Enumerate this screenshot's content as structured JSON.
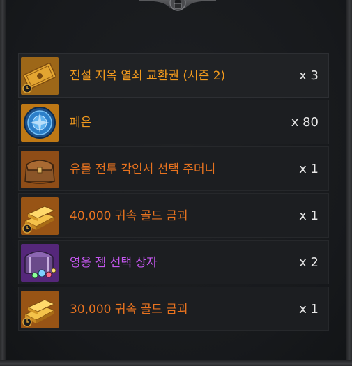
{
  "colors": {
    "legendary": "#f29a1d",
    "legendary_alt": "#e8731f",
    "mythic": "#c557f0",
    "quantity": "#e7e7e7"
  },
  "items": [
    {
      "name": "전설 지옥 열쇠 교환권 (시즌 2)",
      "quantity": "x 3",
      "rarity": "legendary",
      "icon": "legendary-key-ticket-icon"
    },
    {
      "name": "페온",
      "quantity": "x 80",
      "rarity": "legendary",
      "icon": "phon-coin-icon"
    },
    {
      "name": "유물 전투 각인서 선택 주머니",
      "quantity": "x 1",
      "rarity": "legendary_alt",
      "icon": "engraving-pouch-icon"
    },
    {
      "name": "40,000 귀속 골드 금괴",
      "quantity": "x 1",
      "rarity": "legendary_alt",
      "icon": "gold-bar-icon"
    },
    {
      "name": "영웅 젬 선택 상자",
      "quantity": "x 2",
      "rarity": "mythic",
      "icon": "gem-chest-icon"
    },
    {
      "name": "30,000 귀속 골드 금괴",
      "quantity": "x 1",
      "rarity": "legendary_alt",
      "icon": "gold-bar-icon"
    }
  ]
}
